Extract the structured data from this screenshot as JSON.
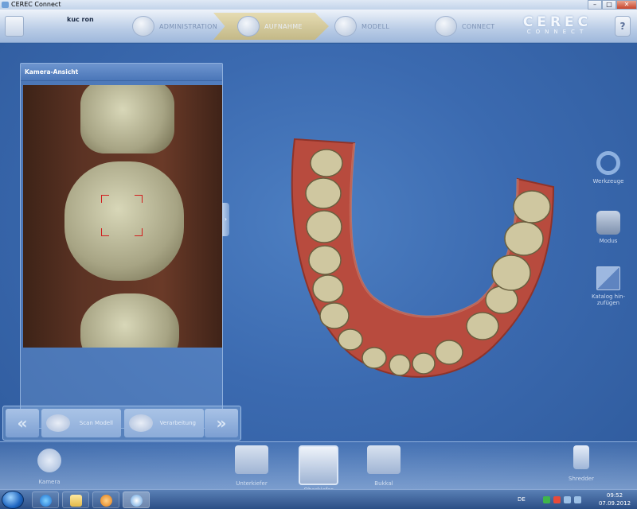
{
  "window": {
    "title": "CEREC Connect",
    "controls": {
      "minimize": "–",
      "maximize": "□",
      "close": "✕"
    }
  },
  "header": {
    "patient_name": "kuc ron",
    "tabs": [
      {
        "label": "ADMINISTRATION",
        "active": false
      },
      {
        "label": "AUFNAHME",
        "active": true
      },
      {
        "label": "MODELL",
        "active": false
      },
      {
        "label": "CONNECT",
        "active": false
      }
    ],
    "brand_line1": "CEREC",
    "brand_line2": "CONNECT",
    "help_glyph": "?"
  },
  "camera_panel": {
    "title": "Kamera-Ansicht",
    "collapse_glyph": "›"
  },
  "right_tools": [
    {
      "label": "Werkzeuge",
      "icon": "ring-icon"
    },
    {
      "label": "Modus",
      "icon": "clapper-icon"
    },
    {
      "label": "Katalog hin-\nzufügen",
      "icon": "catalog-add-icon"
    }
  ],
  "step_bar": {
    "back_glyph": "«",
    "next_glyph": "»",
    "steps": [
      {
        "label": "Scan Modell"
      },
      {
        "label": "Verarbeitung"
      }
    ]
  },
  "bottom_toolbar": {
    "items": [
      {
        "label": "Kamera",
        "selected": false
      },
      {
        "label": "Unterkiefer",
        "selected": false
      },
      {
        "label": "Oberkiefer",
        "selected": true
      },
      {
        "label": "Bukkal",
        "selected": false
      },
      {
        "label": "Shredder",
        "selected": false
      }
    ]
  },
  "taskbar": {
    "language": "DE",
    "time": "09:52",
    "date": "07.09.2012"
  },
  "colors": {
    "background": "#3b6ab0",
    "gum": "#b84b3e",
    "tooth": "#cfc7a0",
    "active_tab": "#d8c98e"
  }
}
